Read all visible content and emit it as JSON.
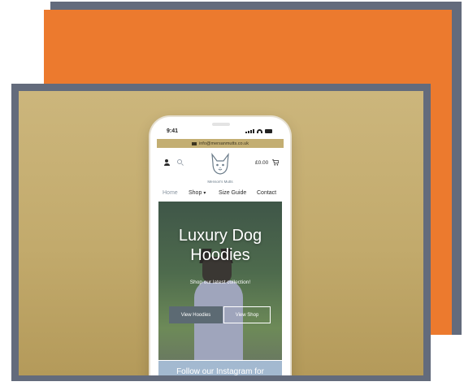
{
  "phone": {
    "status_time": "9:41",
    "topbar_email": "info@mersanmutts.co.uk",
    "brand_name": "Menson's Mutts",
    "cart_total": "£0.00",
    "nav": {
      "home": "Home",
      "shop": "Shop",
      "size_guide": "Size Guide",
      "contact": "Contact"
    },
    "hero": {
      "title_line1": "Luxury Dog",
      "title_line2": "Hoodies",
      "subtitle": "Shop our latest collection!",
      "btn_primary": "View Hoodies",
      "btn_secondary": "View Shop"
    },
    "instagram_banner": "Follow our Instagram for"
  },
  "colors": {
    "orange": "#ec7a2e",
    "slate": "#636b7c",
    "gold": "#c3ae72",
    "banner_blue": "#a3b9d0"
  }
}
